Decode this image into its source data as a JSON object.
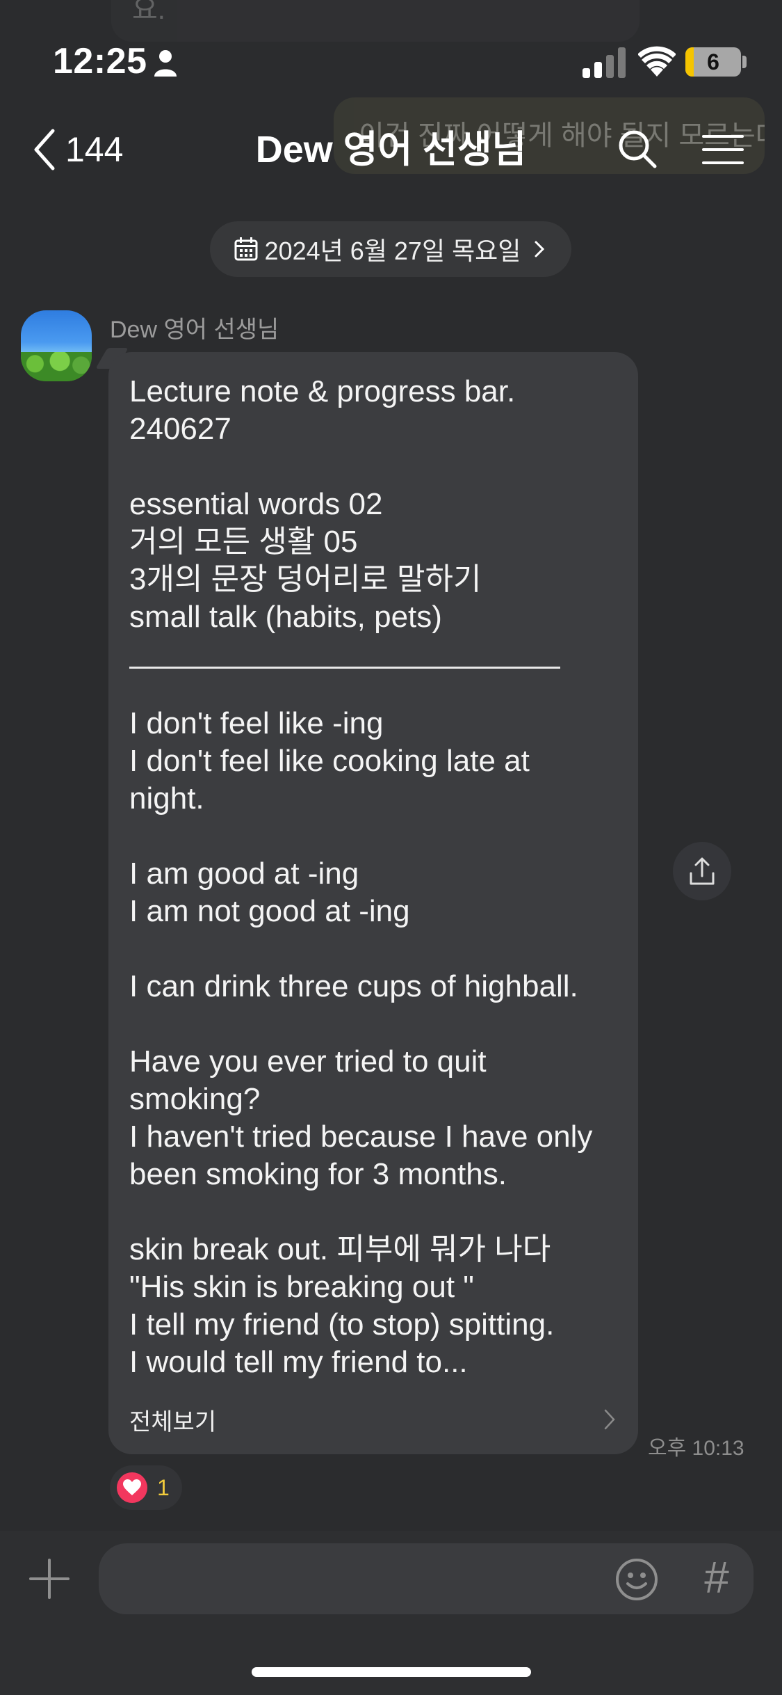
{
  "background_messages": {
    "top_text": "요.",
    "right_text": "이건 진짜 어떻게 해야 될지 모르는데 쓰는 순간 이게 되 ... 겠습니다"
  },
  "status_bar": {
    "time": "12:25",
    "battery_level": "6",
    "icons": [
      "person-icon",
      "signal-icon",
      "wifi-icon",
      "battery-icon"
    ]
  },
  "header": {
    "back_count": "144",
    "title": "Dew 영어 선생님",
    "icons": [
      "back-arrow-icon",
      "search-icon",
      "menu-icon"
    ]
  },
  "date_divider": {
    "label": "2024년 6월 27일 목요일"
  },
  "message": {
    "sender": "Dew 영어 선생님",
    "lines_before_divider": [
      "Lecture note & progress bar.",
      "240627",
      "",
      "essential words 02",
      "거의 모든 생활 05",
      "3개의 문장 덩어리로 말하기",
      "small talk (habits, pets)"
    ],
    "lines_after_divider": [
      "I don't feel like -ing",
      "I don't feel like cooking late at",
      "night.",
      "",
      "I am good at -ing",
      "I am not good at -ing",
      "",
      "I can drink three cups of highball.",
      "",
      "Have you ever tried to quit",
      "smoking?",
      "I haven't tried because I have only",
      "been smoking for 3 months.",
      "",
      "skin break out. 피부에 뭐가 나다",
      "\"His skin is breaking out \"",
      "I tell my friend (to stop) spitting.",
      "I would tell my friend to..."
    ],
    "view_all_label": "전체보기",
    "time": "오후 10:13",
    "reaction_count": "1"
  },
  "input": {
    "value": "",
    "placeholder": "",
    "hash_label": "#"
  },
  "colors": {
    "background": "#2b2c2e",
    "bubble": "#3c3d40",
    "heart": "#f2375e",
    "reaction_count": "#f3cc3c",
    "battery_fill": "#f5c400"
  }
}
